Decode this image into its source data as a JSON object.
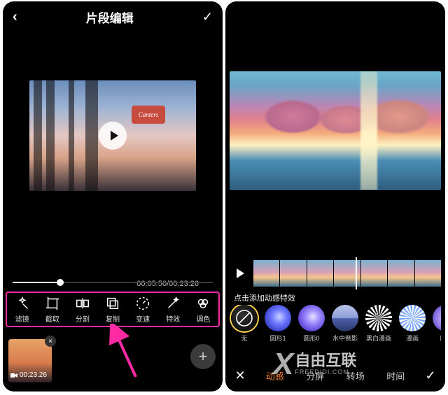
{
  "leftPanel": {
    "header": {
      "title": "片段编辑",
      "back": "‹",
      "confirm": "✓"
    },
    "preview": {
      "signText": "Canters"
    },
    "time": {
      "current": "00:05.50",
      "total": "00:23.26",
      "sep": "/"
    },
    "toolbar": {
      "items": [
        {
          "id": "filter",
          "label": "滤镜",
          "icon": "star-wand-icon"
        },
        {
          "id": "crop",
          "label": "截取",
          "icon": "crop-icon"
        },
        {
          "id": "split",
          "label": "分割",
          "icon": "split-icon"
        },
        {
          "id": "copy",
          "label": "复制",
          "icon": "copy-icon"
        },
        {
          "id": "speed",
          "label": "变速",
          "icon": "speed-icon"
        },
        {
          "id": "fx",
          "label": "特效",
          "icon": "wand-icon"
        },
        {
          "id": "color",
          "label": "调色",
          "icon": "color-icon"
        }
      ]
    },
    "clip": {
      "duration": "00:23.26",
      "closeGlyph": "×"
    },
    "addGlyph": "+",
    "arrowColor": "#ff2aa4"
  },
  "rightPanel": {
    "hint": "点击添加动感特效",
    "stripFrames": 7,
    "effects": [
      {
        "id": "none",
        "label": "无",
        "selected": true,
        "look": "none"
      },
      {
        "id": "circle1",
        "label": "圆形1",
        "selected": false,
        "look": "blue-swirl"
      },
      {
        "id": "circle0",
        "label": "圆形0",
        "selected": false,
        "look": "purple-swirl"
      },
      {
        "id": "refl",
        "label": "水中倒影",
        "selected": false,
        "look": "reflection"
      },
      {
        "id": "bwcomic",
        "label": "黑白漫画",
        "selected": false,
        "look": "bw"
      },
      {
        "id": "comic",
        "label": "漫画",
        "selected": false,
        "look": "radial"
      },
      {
        "id": "outframe",
        "label": "出帧",
        "selected": false,
        "look": "violet"
      }
    ],
    "tabs": {
      "close": "✕",
      "confirm": "✓",
      "items": [
        {
          "id": "dynamic",
          "label": "动感",
          "active": true
        },
        {
          "id": "split",
          "label": "分屏",
          "active": false
        },
        {
          "id": "transition",
          "label": "转场",
          "active": false
        },
        {
          "id": "time",
          "label": "时间",
          "active": false
        }
      ]
    }
  },
  "watermark": {
    "x": "X",
    "brand": "自由互联",
    "domain": "FREEDIDI.COM"
  }
}
